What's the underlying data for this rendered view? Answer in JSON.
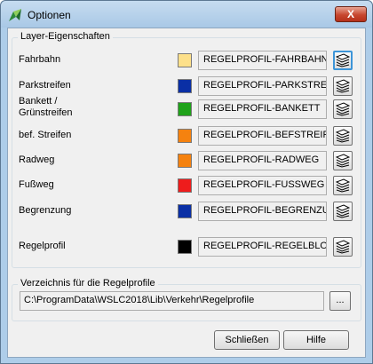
{
  "window": {
    "title": "Optionen",
    "close_symbol": "X"
  },
  "layer_group": {
    "title": "Layer-Eigenschaften",
    "rows": [
      {
        "label": "Fahrbahn",
        "color": "#fde08a",
        "value": "REGELPROFIL-FAHRBAHN"
      },
      {
        "label": "Parkstreifen",
        "color": "#0a2fa5",
        "value": "REGELPROFIL-PARKSTREIFEN"
      },
      {
        "label": "Bankett /\nGrünstreifen",
        "color": "#1fa21a",
        "value": "REGELPROFIL-BANKETT"
      },
      {
        "label": "bef. Streifen",
        "color": "#f5820f",
        "value": "REGELPROFIL-BEFSTREIFEN"
      },
      {
        "label": "Radweg",
        "color": "#f5820f",
        "value": "REGELPROFIL-RADWEG"
      },
      {
        "label": "Fußweg",
        "color": "#ee1c1c",
        "value": "REGELPROFIL-FUSSWEG"
      },
      {
        "label": "Begrenzung",
        "color": "#0a2fa5",
        "value": "REGELPROFIL-BEGRENZUNG"
      },
      {
        "label": "Regelprofil",
        "color": "#000000",
        "value": "REGELPROFIL-REGELBLOCK"
      }
    ]
  },
  "directory_group": {
    "title": "Verzeichnis für die Regelprofile",
    "path": "C:\\ProgramData\\WSLC2018\\Lib\\Verkehr\\Regelprofile",
    "browse_label": "..."
  },
  "buttons": {
    "close": "Schließen",
    "help": "Hilfe"
  },
  "icons": {
    "app": "app-logo-icon",
    "layer_button": "layer-stack-icon"
  }
}
